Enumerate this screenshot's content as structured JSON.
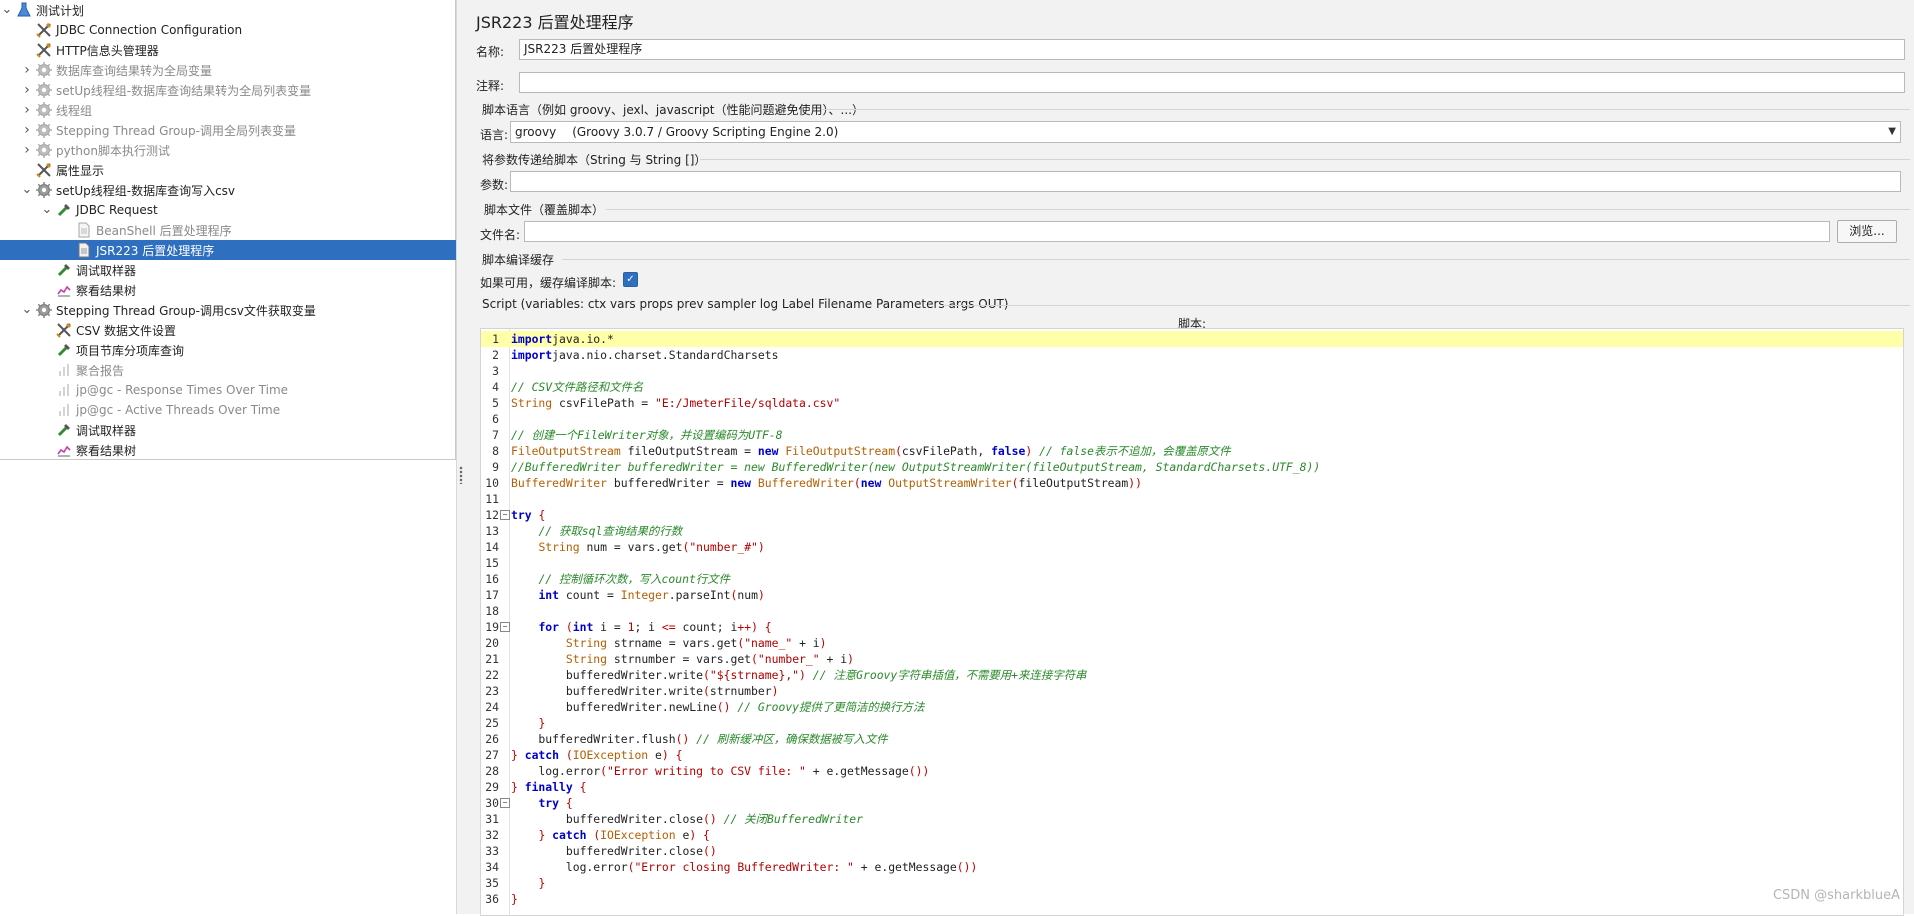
{
  "tree": {
    "items": [
      {
        "label": "测试计划",
        "level": 0,
        "expanded": true,
        "icon": "flask-icon",
        "disabled": false,
        "selected": false,
        "has_children": true
      },
      {
        "label": "JDBC Connection Configuration",
        "level": 1,
        "icon": "wrench-icon",
        "disabled": false,
        "selected": false,
        "has_children": false
      },
      {
        "label": "HTTP信息头管理器",
        "level": 1,
        "icon": "wrench-icon",
        "disabled": false,
        "selected": false,
        "has_children": false
      },
      {
        "label": "数据库查询结果转为全局变量",
        "level": 1,
        "expanded": false,
        "icon": "gear-icon",
        "disabled": true,
        "selected": false,
        "has_children": true
      },
      {
        "label": "setUp线程组-数据库查询结果转为全局列表变量",
        "level": 1,
        "expanded": false,
        "icon": "gear-icon",
        "disabled": true,
        "selected": false,
        "has_children": true
      },
      {
        "label": "线程组",
        "level": 1,
        "expanded": false,
        "icon": "gear-icon",
        "disabled": true,
        "selected": false,
        "has_children": true
      },
      {
        "label": "Stepping Thread Group-调用全局列表变量",
        "level": 1,
        "expanded": false,
        "icon": "gear-icon",
        "disabled": true,
        "selected": false,
        "has_children": true
      },
      {
        "label": "python脚本执行测试",
        "level": 1,
        "expanded": false,
        "icon": "gear-icon",
        "disabled": true,
        "selected": false,
        "has_children": true
      },
      {
        "label": "属性显示",
        "level": 1,
        "icon": "wrench-icon",
        "disabled": false,
        "selected": false,
        "has_children": false
      },
      {
        "label": "setUp线程组-数据库查询写入csv",
        "level": 1,
        "expanded": true,
        "icon": "gear-icon",
        "disabled": false,
        "selected": false,
        "has_children": true
      },
      {
        "label": "JDBC Request",
        "level": 2,
        "expanded": true,
        "icon": "pipette-icon",
        "disabled": false,
        "selected": false,
        "has_children": true
      },
      {
        "label": "BeanShell 后置处理程序",
        "level": 3,
        "icon": "doc-icon",
        "disabled": true,
        "selected": false,
        "has_children": false
      },
      {
        "label": "JSR223 后置处理程序",
        "level": 3,
        "icon": "doc-icon",
        "disabled": false,
        "selected": true,
        "has_children": false
      },
      {
        "label": "调试取样器",
        "level": 2,
        "icon": "pipette-icon",
        "disabled": false,
        "selected": false,
        "has_children": false
      },
      {
        "label": "察看结果树",
        "level": 2,
        "icon": "chart-icon",
        "disabled": false,
        "selected": false,
        "has_children": false
      },
      {
        "label": "Stepping Thread Group-调用csv文件获取变量",
        "level": 1,
        "expanded": true,
        "icon": "gear-icon",
        "disabled": false,
        "selected": false,
        "has_children": true
      },
      {
        "label": "CSV 数据文件设置",
        "level": 2,
        "icon": "wrench-icon",
        "disabled": false,
        "selected": false,
        "has_children": false
      },
      {
        "label": "项目节库分项库查询",
        "level": 2,
        "icon": "pipette-icon",
        "disabled": false,
        "selected": false,
        "has_children": false
      },
      {
        "label": "聚合报告",
        "level": 2,
        "icon": "report-icon",
        "disabled": true,
        "selected": false,
        "has_children": false
      },
      {
        "label": "jp@gc - Response Times Over Time",
        "level": 2,
        "icon": "report-icon",
        "disabled": true,
        "selected": false,
        "has_children": false
      },
      {
        "label": "jp@gc - Active Threads Over Time",
        "level": 2,
        "icon": "report-icon",
        "disabled": true,
        "selected": false,
        "has_children": false
      },
      {
        "label": "调试取样器",
        "level": 2,
        "icon": "pipette-icon",
        "disabled": false,
        "selected": false,
        "has_children": false
      },
      {
        "label": "察看结果树",
        "level": 2,
        "icon": "chart-icon",
        "disabled": false,
        "selected": false,
        "has_children": false
      }
    ]
  },
  "panel": {
    "title": "JSR223 后置处理程序",
    "name_label": "名称:",
    "name_value": "JSR223 后置处理程序",
    "comment_label": "注释:",
    "comment_value": "",
    "lang_section": "脚本语言（例如 groovy、jexl、javascript（性能问题避免使用）、...）",
    "lang_label": "语言:",
    "lang_name": "groovy",
    "lang_engine": "(Groovy 3.0.7 / Groovy Scripting Engine 2.0)",
    "params_section": "将参数传递给脚本（String 与 String []）",
    "params_label": "参数:",
    "params_value": "",
    "file_section": "脚本文件（覆盖脚本）",
    "file_label": "文件名:",
    "file_value": "",
    "browse_button": "浏览...",
    "cache_section": "脚本编译缓存",
    "cache_label": "如果可用，缓存编译脚本:",
    "cache_checked": true,
    "script_vars": "Script (variables: ctx vars props prev sampler log Label Filename Parameters args OUT)",
    "script_label": "脚本:"
  },
  "code": {
    "highlight_line": 1,
    "fold_lines": [
      12,
      19,
      30
    ],
    "lines": [
      [
        [
          "k",
          "import"
        ],
        [
          "",
          "java.io.*"
        ]
      ],
      [
        [
          "k",
          "import"
        ],
        [
          "",
          "java.nio.charset.StandardCharsets"
        ]
      ],
      [],
      [
        [
          "c",
          "// CSV文件路径和文件名"
        ]
      ],
      [
        [
          "t",
          "String"
        ],
        [
          "",
          " csvFilePath = "
        ],
        [
          "s",
          "\"E:/JmeterFile/sqldata.csv\""
        ]
      ],
      [],
      [
        [
          "c",
          "// 创建一个FileWriter对象，并设置编码为UTF-8"
        ]
      ],
      [
        [
          "t",
          "FileOutputStream"
        ],
        [
          "",
          " fileOutputStream = "
        ],
        [
          "k",
          "new"
        ],
        [
          "",
          " "
        ],
        [
          "t",
          "FileOutputStream"
        ],
        [
          "p",
          "("
        ],
        [
          "",
          "csvFilePath, "
        ],
        [
          "k",
          "false"
        ],
        [
          "p",
          ")"
        ],
        [
          "",
          " "
        ],
        [
          "c",
          "// false表示不追加，会覆盖原文件"
        ]
      ],
      [
        [
          "c",
          "//BufferedWriter bufferedWriter = new BufferedWriter(new OutputStreamWriter(fileOutputStream, StandardCharsets.UTF_8))"
        ]
      ],
      [
        [
          "t",
          "BufferedWriter"
        ],
        [
          "",
          " bufferedWriter = "
        ],
        [
          "k",
          "new"
        ],
        [
          "",
          " "
        ],
        [
          "t",
          "BufferedWriter"
        ],
        [
          "p",
          "("
        ],
        [
          "k",
          "new"
        ],
        [
          "",
          " "
        ],
        [
          "t",
          "OutputStreamWriter"
        ],
        [
          "p",
          "("
        ],
        [
          "",
          "fileOutputStream"
        ],
        [
          "p",
          "))"
        ]
      ],
      [],
      [
        [
          "k",
          "try"
        ],
        [
          "",
          " "
        ],
        [
          "p",
          "{"
        ]
      ],
      [
        [
          "",
          "    "
        ],
        [
          "c",
          "// 获取sql查询结果的行数"
        ]
      ],
      [
        [
          "",
          "    "
        ],
        [
          "t",
          "String"
        ],
        [
          "",
          " num = vars.get"
        ],
        [
          "p",
          "("
        ],
        [
          "s",
          "\"number_#\""
        ],
        [
          "p",
          ")"
        ]
      ],
      [],
      [
        [
          "",
          "    "
        ],
        [
          "c",
          "// 控制循环次数，写入count行文件"
        ]
      ],
      [
        [
          "",
          "    "
        ],
        [
          "k",
          "int"
        ],
        [
          "",
          " count = "
        ],
        [
          "t",
          "Integer"
        ],
        [
          "",
          ".parseInt"
        ],
        [
          "p",
          "("
        ],
        [
          "",
          "num"
        ],
        [
          "p",
          ")"
        ]
      ],
      [],
      [
        [
          "",
          "    "
        ],
        [
          "k",
          "for"
        ],
        [
          "",
          " "
        ],
        [
          "p",
          "("
        ],
        [
          "k",
          "int"
        ],
        [
          "",
          " i = "
        ],
        [
          "s",
          "1"
        ],
        [
          "",
          "; i "
        ],
        [
          "p",
          "<="
        ],
        [
          "",
          " count; i"
        ],
        [
          "p",
          "++)"
        ],
        [
          "",
          " "
        ],
        [
          "p",
          "{"
        ]
      ],
      [
        [
          "",
          "        "
        ],
        [
          "t",
          "String"
        ],
        [
          "",
          " strname = vars.get"
        ],
        [
          "p",
          "("
        ],
        [
          "s",
          "\"name_\""
        ],
        [
          "",
          " + i"
        ],
        [
          "p",
          ")"
        ]
      ],
      [
        [
          "",
          "        "
        ],
        [
          "t",
          "String"
        ],
        [
          "",
          " strnumber = vars.get"
        ],
        [
          "p",
          "("
        ],
        [
          "s",
          "\"number_\""
        ],
        [
          "",
          " + i"
        ],
        [
          "p",
          ")"
        ]
      ],
      [
        [
          "",
          "        bufferedWriter.write"
        ],
        [
          "p",
          "("
        ],
        [
          "s",
          "\"${strname},\""
        ],
        [
          "p",
          ")"
        ],
        [
          "",
          " "
        ],
        [
          "c",
          "// 注意Groovy字符串插值，不需要用+来连接字符串"
        ]
      ],
      [
        [
          "",
          "        bufferedWriter.write"
        ],
        [
          "p",
          "("
        ],
        [
          "",
          "strnumber"
        ],
        [
          "p",
          ")"
        ]
      ],
      [
        [
          "",
          "        bufferedWriter.newLine"
        ],
        [
          "p",
          "()"
        ],
        [
          "",
          " "
        ],
        [
          "c",
          "// Groovy提供了更简洁的换行方法"
        ]
      ],
      [
        [
          "",
          "    "
        ],
        [
          "p",
          "}"
        ]
      ],
      [
        [
          "",
          "    bufferedWriter.flush"
        ],
        [
          "p",
          "()"
        ],
        [
          "",
          " "
        ],
        [
          "c",
          "// 刷新缓冲区，确保数据被写入文件"
        ]
      ],
      [
        [
          "p",
          "}"
        ],
        [
          "",
          " "
        ],
        [
          "k",
          "catch"
        ],
        [
          "",
          " "
        ],
        [
          "p",
          "("
        ],
        [
          "t",
          "IOException"
        ],
        [
          "",
          " e"
        ],
        [
          "p",
          ")"
        ],
        [
          "",
          " "
        ],
        [
          "p",
          "{"
        ]
      ],
      [
        [
          "",
          "    log.error"
        ],
        [
          "p",
          "("
        ],
        [
          "s",
          "\"Error writing to CSV file: \""
        ],
        [
          "",
          " + e.getMessage"
        ],
        [
          "p",
          "())"
        ]
      ],
      [
        [
          "p",
          "}"
        ],
        [
          "",
          " "
        ],
        [
          "k",
          "finally"
        ],
        [
          "",
          " "
        ],
        [
          "p",
          "{"
        ]
      ],
      [
        [
          "",
          "    "
        ],
        [
          "k",
          "try"
        ],
        [
          "",
          " "
        ],
        [
          "p",
          "{"
        ]
      ],
      [
        [
          "",
          "        bufferedWriter.close"
        ],
        [
          "p",
          "()"
        ],
        [
          "",
          " "
        ],
        [
          "c",
          "// 关闭BufferedWriter"
        ]
      ],
      [
        [
          "",
          "    "
        ],
        [
          "p",
          "}"
        ],
        [
          "",
          " "
        ],
        [
          "k",
          "catch"
        ],
        [
          "",
          " "
        ],
        [
          "p",
          "("
        ],
        [
          "t",
          "IOException"
        ],
        [
          "",
          " e"
        ],
        [
          "p",
          ")"
        ],
        [
          "",
          " "
        ],
        [
          "p",
          "{"
        ]
      ],
      [
        [
          "",
          "        bufferedWriter.close"
        ],
        [
          "p",
          "()"
        ]
      ],
      [
        [
          "",
          "        log.error"
        ],
        [
          "p",
          "("
        ],
        [
          "s",
          "\"Error closing BufferedWriter: \""
        ],
        [
          "",
          " + e.getMessage"
        ],
        [
          "p",
          "())"
        ]
      ],
      [
        [
          "",
          "    "
        ],
        [
          "p",
          "}"
        ]
      ],
      [
        [
          "p",
          "}"
        ]
      ]
    ]
  },
  "watermark": "CSDN @sharkblueA",
  "colors": {
    "selection": "#2f6fc0",
    "keyword": "#0000c8",
    "type": "#b55e00",
    "string": "#b40000",
    "comment": "#2a8a2a",
    "current_line": "#ffffa8"
  }
}
